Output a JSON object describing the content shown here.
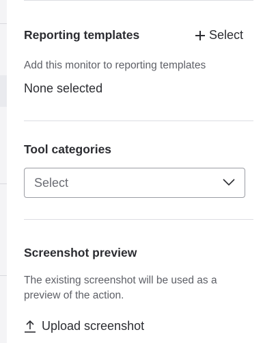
{
  "reporting_templates": {
    "title": "Reporting templates",
    "select_label": "Select",
    "description": "Add this monitor to reporting templates",
    "value": "None selected"
  },
  "tool_categories": {
    "title": "Tool categories",
    "placeholder": "Select"
  },
  "screenshot_preview": {
    "title": "Screenshot preview",
    "description": "The existing screenshot will be used as a preview of the action.",
    "upload_label": "Upload screenshot"
  },
  "icons": {
    "select": "plus-icon",
    "dropdown": "chevron-down-icon",
    "upload": "upload-icon"
  },
  "colors": {
    "text": "#2b2c31",
    "muted": "#5d5f66",
    "divider": "#dcdde2",
    "border": "#9a9ca3"
  }
}
